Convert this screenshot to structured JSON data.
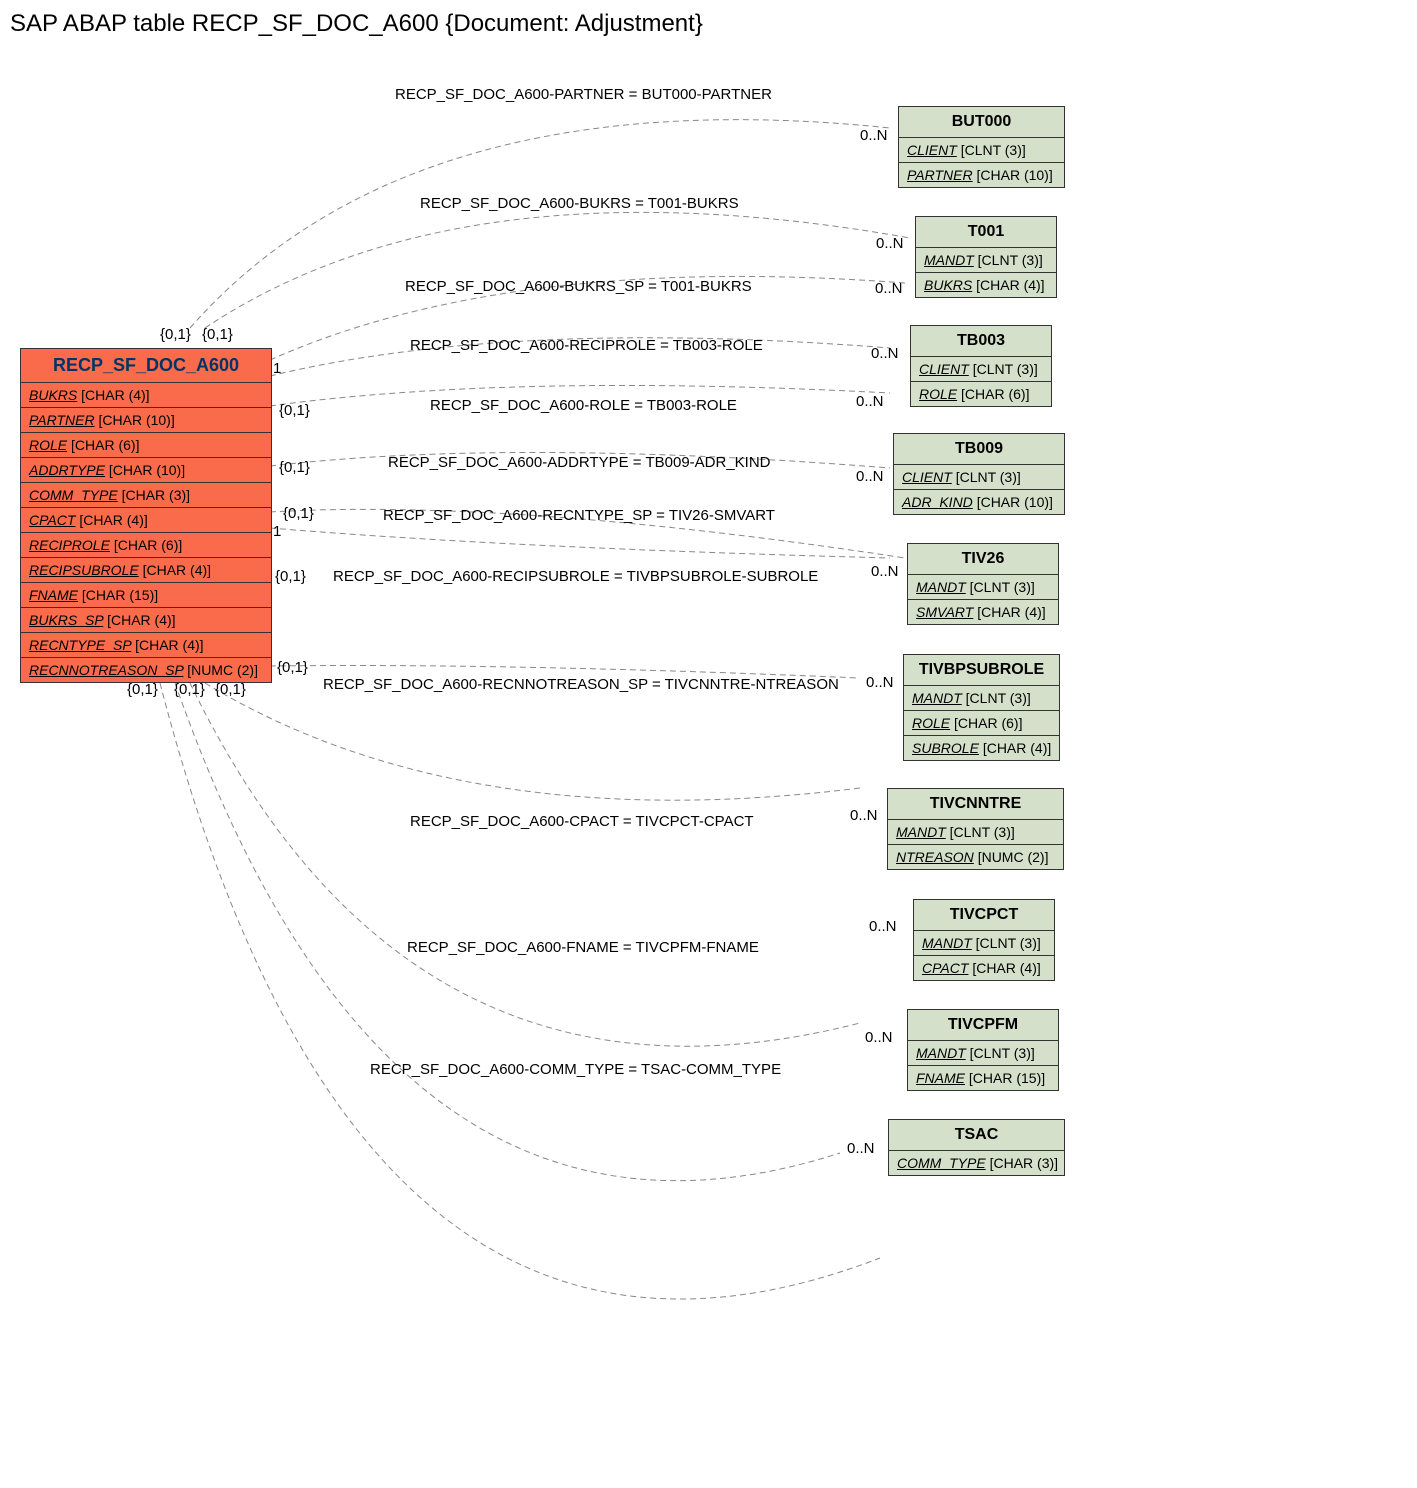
{
  "title": "SAP ABAP table RECP_SF_DOC_A600 {Document: Adjustment}",
  "mainEntity": {
    "name": "RECP_SF_DOC_A600",
    "fields": [
      {
        "name": "BUKRS",
        "type": "[CHAR (4)]"
      },
      {
        "name": "PARTNER",
        "type": "[CHAR (10)]"
      },
      {
        "name": "ROLE",
        "type": "[CHAR (6)]"
      },
      {
        "name": "ADDRTYPE",
        "type": "[CHAR (10)]"
      },
      {
        "name": "COMM_TYPE",
        "type": "[CHAR (3)]"
      },
      {
        "name": "CPACT",
        "type": "[CHAR (4)]"
      },
      {
        "name": "RECIPROLE",
        "type": "[CHAR (6)]"
      },
      {
        "name": "RECIPSUBROLE",
        "type": "[CHAR (4)]"
      },
      {
        "name": "FNAME",
        "type": "[CHAR (15)]"
      },
      {
        "name": "BUKRS_SP",
        "type": "[CHAR (4)]"
      },
      {
        "name": "RECNTYPE_SP",
        "type": "[CHAR (4)]"
      },
      {
        "name": "RECNNOTREASON_SP",
        "type": "[NUMC (2)]"
      }
    ]
  },
  "targets": [
    {
      "name": "BUT000",
      "fields": [
        {
          "name": "CLIENT",
          "type": "[CLNT (3)]"
        },
        {
          "name": "PARTNER",
          "type": "[CHAR (10)]"
        }
      ]
    },
    {
      "name": "T001",
      "fields": [
        {
          "name": "MANDT",
          "type": "[CLNT (3)]"
        },
        {
          "name": "BUKRS",
          "type": "[CHAR (4)]"
        }
      ]
    },
    {
      "name": "TB003",
      "fields": [
        {
          "name": "CLIENT",
          "type": "[CLNT (3)]"
        },
        {
          "name": "ROLE",
          "type": "[CHAR (6)]"
        }
      ]
    },
    {
      "name": "TB009",
      "fields": [
        {
          "name": "CLIENT",
          "type": "[CLNT (3)]"
        },
        {
          "name": "ADR_KIND",
          "type": "[CHAR (10)]"
        }
      ]
    },
    {
      "name": "TIV26",
      "fields": [
        {
          "name": "MANDT",
          "type": "[CLNT (3)]"
        },
        {
          "name": "SMVART",
          "type": "[CHAR (4)]"
        }
      ]
    },
    {
      "name": "TIVBPSUBROLE",
      "fields": [
        {
          "name": "MANDT",
          "type": "[CLNT (3)]"
        },
        {
          "name": "ROLE",
          "type": "[CHAR (6)]"
        },
        {
          "name": "SUBROLE",
          "type": "[CHAR (4)]"
        }
      ]
    },
    {
      "name": "TIVCNNTRE",
      "fields": [
        {
          "name": "MANDT",
          "type": "[CLNT (3)]"
        },
        {
          "name": "NTREASON",
          "type": "[NUMC (2)]"
        }
      ]
    },
    {
      "name": "TIVCPCT",
      "fields": [
        {
          "name": "MANDT",
          "type": "[CLNT (3)]"
        },
        {
          "name": "CPACT",
          "type": "[CHAR (4)]"
        }
      ]
    },
    {
      "name": "TIVCPFM",
      "fields": [
        {
          "name": "MANDT",
          "type": "[CLNT (3)]"
        },
        {
          "name": "FNAME",
          "type": "[CHAR (15)]"
        }
      ]
    },
    {
      "name": "TSAC",
      "fields": [
        {
          "name": "COMM_TYPE",
          "type": "[CHAR (3)]"
        }
      ]
    }
  ],
  "relations": [
    {
      "text": "RECP_SF_DOC_A600-PARTNER = BUT000-PARTNER"
    },
    {
      "text": "RECP_SF_DOC_A600-BUKRS = T001-BUKRS"
    },
    {
      "text": "RECP_SF_DOC_A600-BUKRS_SP = T001-BUKRS"
    },
    {
      "text": "RECP_SF_DOC_A600-RECIPROLE = TB003-ROLE"
    },
    {
      "text": "RECP_SF_DOC_A600-ROLE = TB003-ROLE"
    },
    {
      "text": "RECP_SF_DOC_A600-ADDRTYPE = TB009-ADR_KIND"
    },
    {
      "text": "RECP_SF_DOC_A600-RECNTYPE_SP = TIV26-SMVART"
    },
    {
      "text": "RECP_SF_DOC_A600-RECIPSUBROLE = TIVBPSUBROLE-SUBROLE"
    },
    {
      "text": "RECP_SF_DOC_A600-RECNNOTREASON_SP = TIVCNNTRE-NTREASON"
    },
    {
      "text": "RECP_SF_DOC_A600-CPACT = TIVCPCT-CPACT"
    },
    {
      "text": "RECP_SF_DOC_A600-FNAME = TIVCPFM-FNAME"
    },
    {
      "text": "RECP_SF_DOC_A600-COMM_TYPE = TSAC-COMM_TYPE"
    }
  ],
  "leftCards": [
    {
      "text": "{0,1}"
    },
    {
      "text": "{0,1}"
    },
    {
      "text": "1"
    },
    {
      "text": "{0,1}"
    },
    {
      "text": "{0,1}"
    },
    {
      "text": "{0,1}"
    },
    {
      "text": "1"
    },
    {
      "text": "{0,1}"
    },
    {
      "text": "{0,1}"
    },
    {
      "text": "{0,1}"
    },
    {
      "text": "{0,1}"
    },
    {
      "text": "{0,1}"
    }
  ],
  "rightCards": [
    {
      "text": "0..N"
    },
    {
      "text": "0..N"
    },
    {
      "text": "0..N"
    },
    {
      "text": "0..N"
    },
    {
      "text": "0..N"
    },
    {
      "text": "0..N"
    },
    {
      "text": "0..N"
    },
    {
      "text": "0..N"
    },
    {
      "text": "0..N"
    },
    {
      "text": "0..N"
    },
    {
      "text": "0..N"
    },
    {
      "text": "0..N"
    }
  ]
}
